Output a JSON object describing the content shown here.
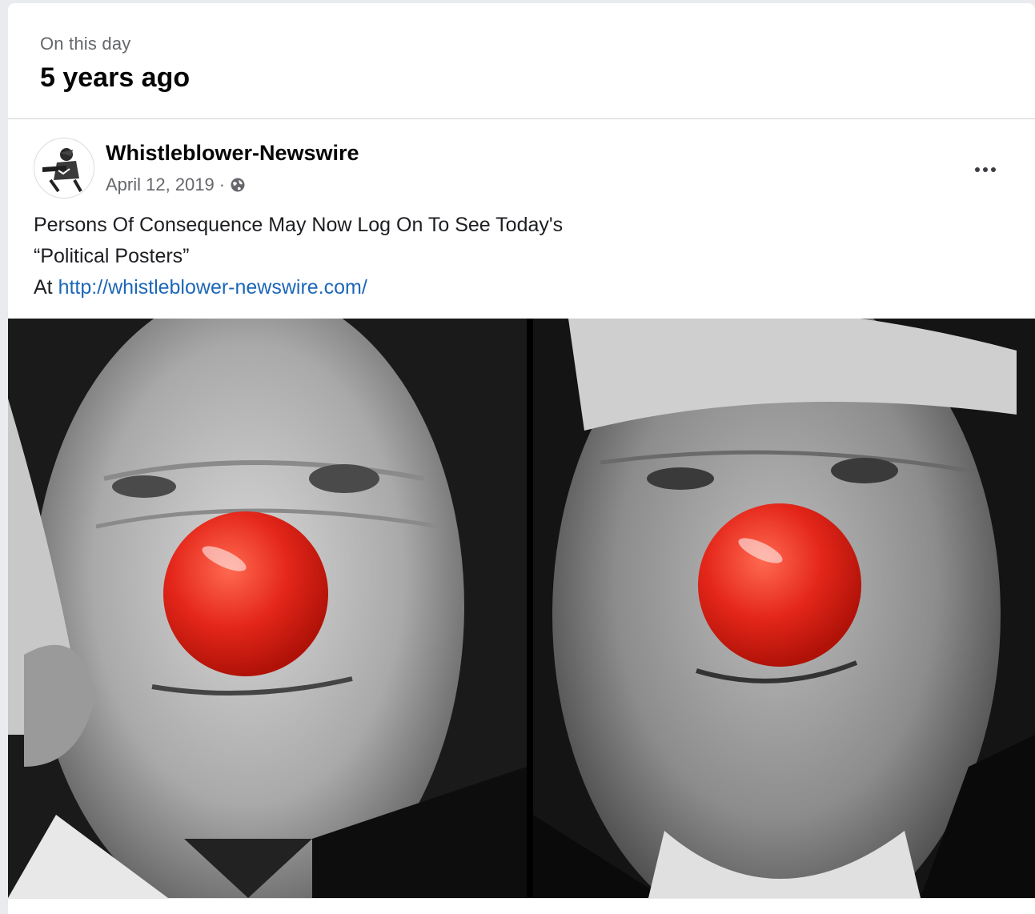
{
  "memory": {
    "kicker": "On this day",
    "title": "5 years ago"
  },
  "post": {
    "page_name": "Whistleblower-Newswire",
    "date": "April 12, 2019",
    "separator": "·",
    "privacy_icon": "globe-icon",
    "more_icon": "more-options-icon",
    "text_line1": "Persons Of Consequence May Now Log On To See Today's",
    "text_line2": "“Political Posters”",
    "text_line3_prefix": "At ",
    "link_text": "http://whistleblower-newswire.com/",
    "link_color": "#1d67b8"
  },
  "image": {
    "description_icon": "photo",
    "nose_color": "#e4261a"
  }
}
